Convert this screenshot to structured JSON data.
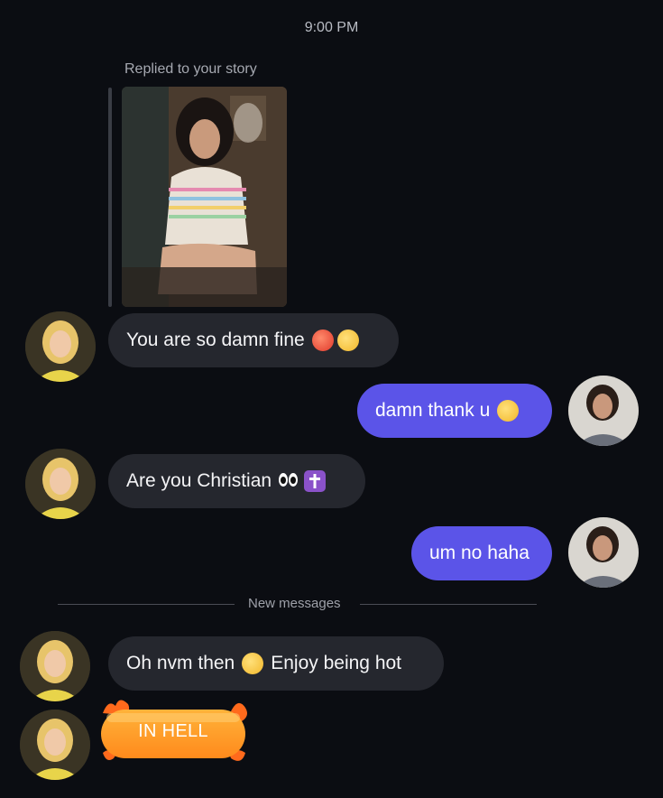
{
  "timestamp": "9:00 PM",
  "story_reply": {
    "label": "Replied to your story"
  },
  "messages": [
    {
      "from": "them",
      "text": "You are so damn fine",
      "emojis": [
        "hot-face-emoji",
        "weary-face-emoji"
      ]
    },
    {
      "from": "me",
      "text": "damn thank u",
      "emojis": [
        "loudly-crying-face-emoji"
      ]
    },
    {
      "from": "them",
      "text": "Are you Christian",
      "emojis": [
        "eyes-emoji",
        "latin-cross-emoji"
      ]
    },
    {
      "from": "me",
      "text": "um no haha",
      "emojis": []
    },
    {
      "from": "them",
      "text": "Oh nvm then",
      "emojis": [
        "tears-of-joy-emoji"
      ],
      "text_after": "Enjoy being hot"
    },
    {
      "from": "them",
      "text": "IN HELL",
      "effect": "fire"
    }
  ],
  "divider": {
    "label": "New messages"
  },
  "colors": {
    "background": "#0b0d12",
    "incoming_bubble": "#25272e",
    "outgoing_bubble": "#5b54e8",
    "fire_bubble": "#ff9a2a"
  }
}
